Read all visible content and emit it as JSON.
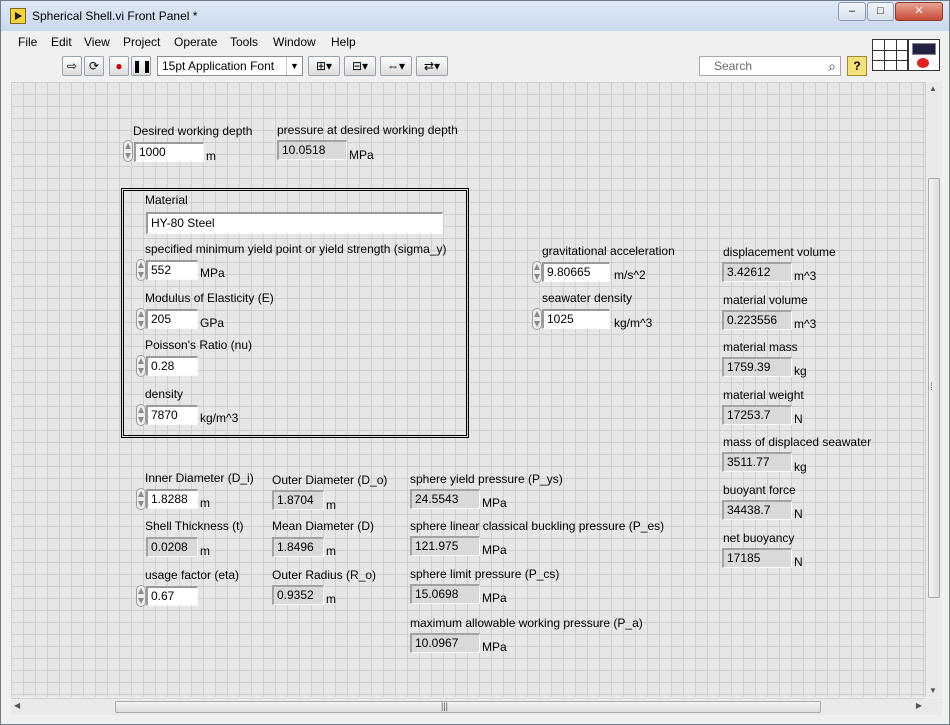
{
  "window": {
    "title": "Spherical Shell.vi Front Panel *",
    "controls": {
      "minimize": "–",
      "maximize": "□",
      "close": "✕"
    }
  },
  "menu": [
    "File",
    "Edit",
    "View",
    "Project",
    "Operate",
    "Tools",
    "Window",
    "Help"
  ],
  "toolbar": {
    "font": "15pt Application Font",
    "search_placeholder": "Search",
    "help": "?"
  },
  "panel": {
    "working_depth": {
      "label": "Desired working depth",
      "value": "1000",
      "unit": "m"
    },
    "pressure_depth": {
      "label": "pressure at desired working depth",
      "value": "10.0518",
      "unit": "MPa"
    },
    "material": {
      "label": "Material",
      "value": "HY-80 Steel"
    },
    "yield_strength": {
      "label": "specified minimum yield point or yield strength (sigma_y)",
      "value": "552",
      "unit": "MPa"
    },
    "modulus": {
      "label": "Modulus of Elasticity (E)",
      "value": "205",
      "unit": "GPa"
    },
    "poisson": {
      "label": "Poisson's Ratio (nu)",
      "value": "0.28"
    },
    "density": {
      "label": "density",
      "value": "7870",
      "unit": "kg/m^3"
    },
    "gravity": {
      "label": "gravitational acceleration",
      "value": "9.80665",
      "unit": "m/s^2"
    },
    "seawater_density": {
      "label": "seawater density",
      "value": "1025",
      "unit": "kg/m^3"
    },
    "displacement_volume": {
      "label": "displacement volume",
      "value": "3.42612",
      "unit": "m^3"
    },
    "material_volume": {
      "label": "material volume",
      "value": "0.223556",
      "unit": "m^3"
    },
    "material_mass": {
      "label": "material mass",
      "value": "1759.39",
      "unit": "kg"
    },
    "material_weight": {
      "label": "material weight",
      "value": "17253.7",
      "unit": "N"
    },
    "displaced_mass": {
      "label": "mass of displaced seawater",
      "value": "3511.77",
      "unit": "kg"
    },
    "buoyant_force": {
      "label": "buoyant force",
      "value": "34438.7",
      "unit": "N"
    },
    "net_buoyancy": {
      "label": "net buoyancy",
      "value": "17185",
      "unit": "N"
    },
    "inner_diameter": {
      "label": "Inner Diameter (D_i)",
      "value": "1.8288",
      "unit": "m"
    },
    "outer_diameter": {
      "label": "Outer Diameter (D_o)",
      "value": "1.8704",
      "unit": "m"
    },
    "shell_thickness": {
      "label": "Shell Thickness (t)",
      "value": "0.0208",
      "unit": "m"
    },
    "mean_diameter": {
      "label": "Mean Diameter (D)",
      "value": "1.8496",
      "unit": "m"
    },
    "usage_factor": {
      "label": "usage factor (eta)",
      "value": "0.67"
    },
    "outer_radius": {
      "label": "Outer Radius (R_o)",
      "value": "0.9352",
      "unit": "m"
    },
    "yield_pressure": {
      "label": "sphere yield pressure (P_ys)",
      "value": "24.5543",
      "unit": "MPa"
    },
    "buckling_pressure": {
      "label": "sphere linear classical buckling pressure (P_es)",
      "value": "121.975",
      "unit": "MPa"
    },
    "limit_pressure": {
      "label": "sphere limit pressure (P_cs)",
      "value": "15.0698",
      "unit": "MPa"
    },
    "allowable_pressure": {
      "label": "maximum allowable working pressure (P_a)",
      "value": "10.0967",
      "unit": "MPa"
    }
  },
  "scrollbars": {
    "grip": "⁞",
    "hgrip": "|||"
  }
}
